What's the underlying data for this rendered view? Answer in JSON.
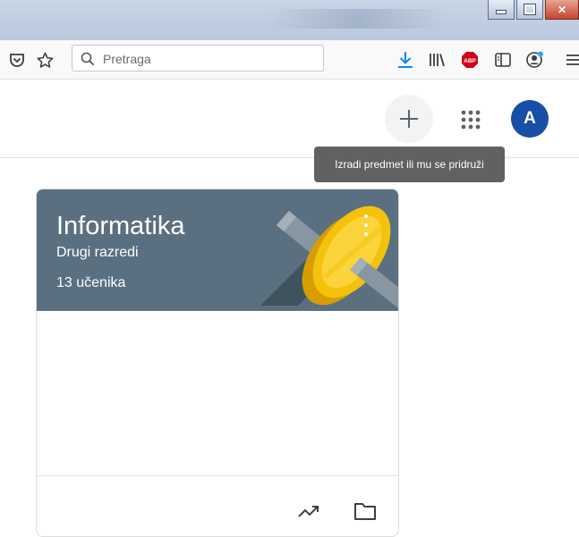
{
  "browser": {
    "search": {
      "placeholder": "Pretraga",
      "value": ""
    },
    "toolbar_icons": [
      "pocket-icon",
      "bookmark-star-icon",
      "download-icon",
      "library-icon",
      "adblock-plus-icon",
      "sidebar-icon",
      "account-icon",
      "menu-icon"
    ],
    "adblock_label": "ABP"
  },
  "header": {
    "avatar_initial": "A",
    "tooltip": "Izradi predmet ili mu se pridruži"
  },
  "class_card": {
    "title": "Informatika",
    "section": "Drugi razredi",
    "students": "13 učenika",
    "banner_color": "#5a7080"
  },
  "colors": {
    "accent_blue": "#174ea6",
    "download_blue": "#0a84ff",
    "abp_red": "#d0021b"
  }
}
